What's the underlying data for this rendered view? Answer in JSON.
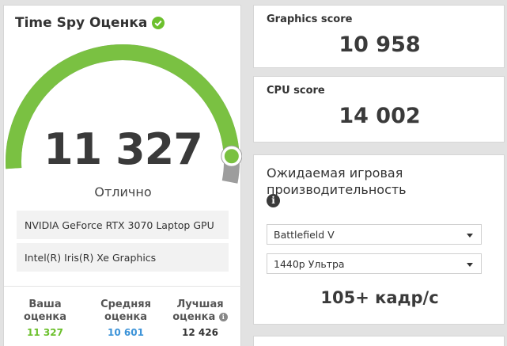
{
  "score_panel": {
    "title": "Time Spy Оценка",
    "score": "11 327",
    "rating": "Отлично",
    "hardware": [
      "NVIDIA GeForce RTX 3070 Laptop GPU",
      "Intel(R) Iris(R) Xe Graphics"
    ],
    "gauge_fraction": 0.93,
    "stats": [
      {
        "label_line1": "Ваша",
        "label_line2": "оценка",
        "value": "11 327",
        "color": "#6cc02d"
      },
      {
        "label_line1": "Средняя",
        "label_line2": "оценка",
        "value": "10 601",
        "color": "#3c93d8"
      },
      {
        "label_line1": "Лучшая",
        "label_line2": "оценка",
        "value": "12 426",
        "color": "#333333",
        "info_icon": "i"
      }
    ]
  },
  "graphics": {
    "label": "Graphics score",
    "value": "10 958"
  },
  "cpu": {
    "label": "CPU score",
    "value": "14 002"
  },
  "performance": {
    "title": "Ожидаемая игровая производительность",
    "info_icon": "i",
    "game_select": "Battlefield V",
    "resolution_select": "1440p Ультра",
    "fps": "105+ кадр/с"
  },
  "colors": {
    "accent_green": "#7ac142",
    "gauge_track": "#9d9d9d",
    "average_blue": "#3c93d8"
  }
}
